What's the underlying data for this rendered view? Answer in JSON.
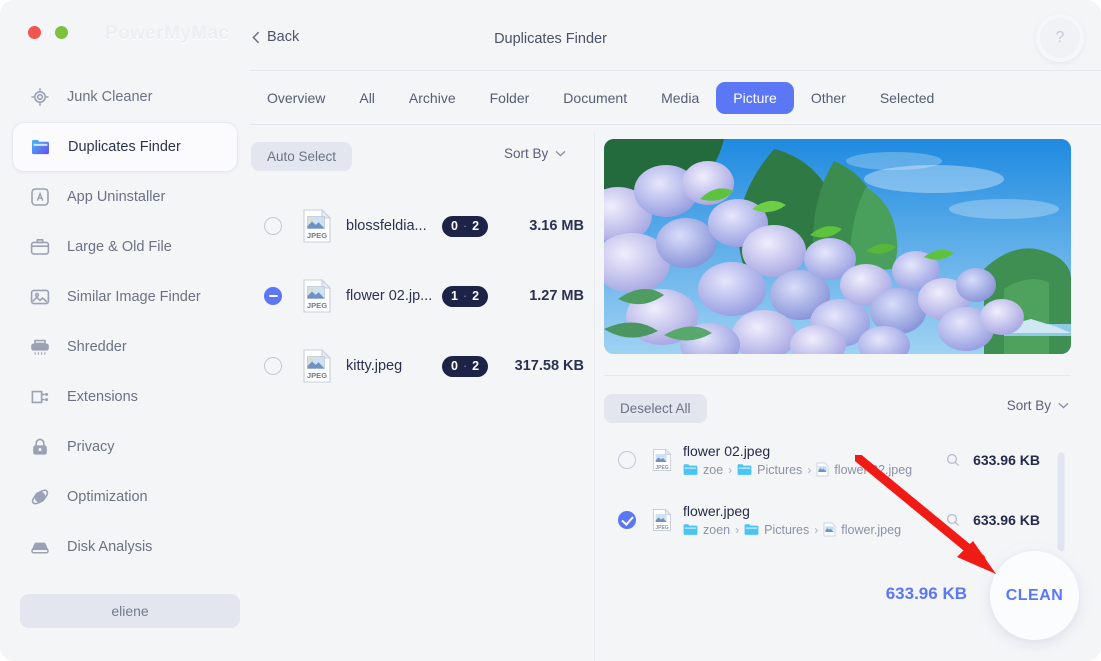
{
  "window": {
    "brand": "PowerMyMac",
    "title": "Duplicates Finder",
    "back_label": "Back",
    "help_label": "?",
    "accent_color": "#5b77f5",
    "badge_color": "#1d2347",
    "background_color": "#f4f5f7"
  },
  "sidebar": {
    "items": [
      {
        "label": "Junk Cleaner",
        "icon": "junk-cleaner-icon",
        "active": false
      },
      {
        "label": "Duplicates Finder",
        "icon": "duplicates-finder-icon",
        "active": true
      },
      {
        "label": "App Uninstaller",
        "icon": "app-uninstaller-icon",
        "active": false
      },
      {
        "label": "Large & Old File",
        "icon": "large-old-file-icon",
        "active": false
      },
      {
        "label": "Similar Image Finder",
        "icon": "similar-image-finder-icon",
        "active": false
      },
      {
        "label": "Shredder",
        "icon": "shredder-icon",
        "active": false
      },
      {
        "label": "Extensions",
        "icon": "extensions-icon",
        "active": false
      },
      {
        "label": "Privacy",
        "icon": "privacy-icon",
        "active": false
      },
      {
        "label": "Optimization",
        "icon": "optimization-icon",
        "active": false
      },
      {
        "label": "Disk Analysis",
        "icon": "disk-analysis-icon",
        "active": false
      }
    ],
    "user_button": "eliene"
  },
  "tabs": [
    {
      "label": "Overview",
      "active": false
    },
    {
      "label": "All",
      "active": false
    },
    {
      "label": "Archive",
      "active": false
    },
    {
      "label": "Folder",
      "active": false
    },
    {
      "label": "Document",
      "active": false
    },
    {
      "label": "Media",
      "active": false
    },
    {
      "label": "Picture",
      "active": true
    },
    {
      "label": "Other",
      "active": false
    },
    {
      "label": "Selected",
      "active": false
    }
  ],
  "left_panel": {
    "auto_select_label": "Auto Select",
    "sort_by_label": "Sort By",
    "rows": [
      {
        "name": "blossfeldia...",
        "selected_count": "0",
        "total_count": "2",
        "separator": "·",
        "size": "3.16 MB",
        "state": "unchecked"
      },
      {
        "name": "flower 02.jp...",
        "selected_count": "1",
        "total_count": "2",
        "separator": "·",
        "size": "1.27 MB",
        "state": "indeterminate"
      },
      {
        "name": "kitty.jpeg",
        "selected_count": "0",
        "total_count": "2",
        "separator": "·",
        "size": "317.58 KB",
        "state": "unchecked"
      }
    ]
  },
  "preview": {
    "alt": "hydrangea-field-photo"
  },
  "right_panel": {
    "deselect_all_label": "Deselect All",
    "sort_by_label": "Sort By",
    "rows": [
      {
        "name": "flower 02.jpeg",
        "crumb1": "zoe",
        "crumb2": "Pictures",
        "crumb3": "flower 02.jpeg",
        "chev": "›",
        "size": "633.96 KB",
        "state": "unchecked"
      },
      {
        "name": "flower.jpeg",
        "crumb1": "zoen",
        "crumb2": "Pictures",
        "crumb3": "flower.jpeg",
        "chev": "›",
        "size": "633.96 KB",
        "state": "checked"
      }
    ]
  },
  "footer": {
    "total_size": "633.96 KB",
    "clean_label": "CLEAN"
  },
  "annotation": {
    "arrow_color": "#f11b16",
    "target": "clean-button"
  }
}
